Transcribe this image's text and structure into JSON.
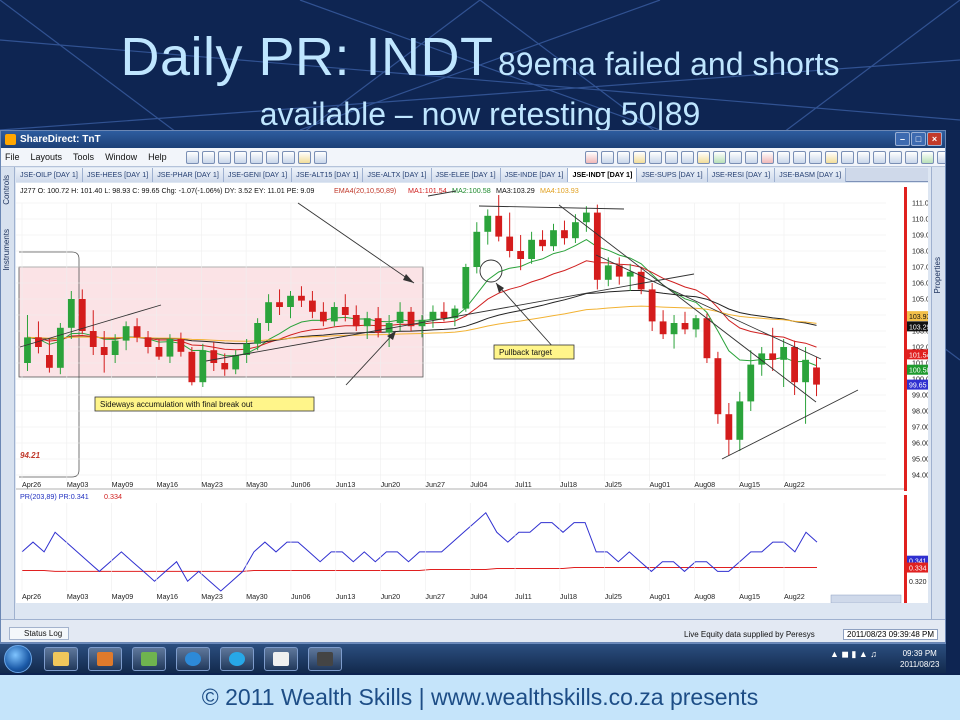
{
  "slide": {
    "title_main": "Daily PR: INDT",
    "title_sub": "89ema failed and shorts",
    "title_line2": "available – now retesting 50|89",
    "footer": "© 2011 Wealth Skills | www.wealthskills.co.za presents"
  },
  "window": {
    "title": "ShareDirect: TnT",
    "menu": [
      "File",
      "Layouts",
      "Tools",
      "Window",
      "Help"
    ],
    "side_tabs": [
      "Controls",
      "Instruments"
    ],
    "right_tab": "Properties",
    "tabs": [
      "JSE-OILP [DAY 1]",
      "JSE-HEES [DAY 1]",
      "JSE-PHAR [DAY 1]",
      "JSE-GENI [DAY 1]",
      "JSE-ALT15 [DAY 1]",
      "JSE-ALTX [DAY 1]",
      "JSE-ELEE [DAY 1]",
      "JSE-INDE [DAY 1]",
      "JSE-INDT [DAY 1]",
      "JSE-SUPS [DAY 1]",
      "JSE-RESI [DAY 1]",
      "JSE-BASM [DAY 1]"
    ],
    "active_tab": "JSE-INDT [DAY 1]",
    "status_log": "Status Log",
    "feed_text": "Live Equity data supplied by Peresys",
    "feed_time": "2011/08/23 09:39:48 PM"
  },
  "chart_header": {
    "ohlc": "J277 O: 100.72 H: 101.40 L: 98.93 C: 99.65 Chg: -1.07(-1.06%) DY: 3.52 EY: 11.01 PE: 9.09",
    "ema": "EMA4(20,10,50,89)",
    "ma1": "MA1:101.54",
    "ma2": "MA2:100.58",
    "ma3": "MA3:103.29",
    "ma4": "MA4:103.93",
    "pr_label": "PR(203,89) PR:0.341",
    "pr_value": "0.334"
  },
  "annotations": {
    "pullback": "Pullback target",
    "sideways": "Sideways accumulation with final break out",
    "low_value": "94.21"
  },
  "chart_data": {
    "type": "candlestick",
    "x_tick_labels": [
      "Apr26",
      "May03",
      "May09",
      "May16",
      "May23",
      "May30",
      "Jun06",
      "Jun13",
      "Jun20",
      "Jun27",
      "Jul04",
      "Jul11",
      "Jul18",
      "Jul25",
      "Aug01",
      "Aug08",
      "Aug15",
      "Aug22"
    ],
    "y_tick_labels": [
      "111.00",
      "110.00",
      "109.00",
      "108.00",
      "107.00",
      "106.00",
      "105.00",
      "104.00",
      "103.00",
      "102.00",
      "101.00",
      "100.00",
      "99.00",
      "98.00",
      "97.00",
      "96.00",
      "95.00",
      "94.00"
    ],
    "ylim": [
      94,
      111
    ],
    "price_markers": [
      {
        "value": "103.93",
        "color": "#f3c04a"
      },
      {
        "value": "103.29",
        "color": "#111111"
      },
      {
        "value": "101.54",
        "color": "#e02020"
      },
      {
        "value": "100.58",
        "color": "#1e9a2e"
      },
      {
        "value": "99.65",
        "color": "#3030d0"
      }
    ],
    "candles": [
      {
        "o": 101.0,
        "h": 104.0,
        "l": 100.5,
        "c": 102.6
      },
      {
        "o": 102.6,
        "h": 103.6,
        "l": 101.6,
        "c": 102.0
      },
      {
        "o": 101.5,
        "h": 102.5,
        "l": 100.4,
        "c": 100.7
      },
      {
        "o": 100.7,
        "h": 103.5,
        "l": 100.3,
        "c": 103.2
      },
      {
        "o": 103.2,
        "h": 105.5,
        "l": 102.5,
        "c": 105.0
      },
      {
        "o": 105.0,
        "h": 105.6,
        "l": 102.8,
        "c": 103.0
      },
      {
        "o": 103.0,
        "h": 104.3,
        "l": 101.5,
        "c": 102.0
      },
      {
        "o": 102.0,
        "h": 103.0,
        "l": 100.4,
        "c": 101.5
      },
      {
        "o": 101.5,
        "h": 102.8,
        "l": 101.0,
        "c": 102.4
      },
      {
        "o": 102.4,
        "h": 103.6,
        "l": 101.8,
        "c": 103.3
      },
      {
        "o": 103.3,
        "h": 103.8,
        "l": 102.3,
        "c": 102.6
      },
      {
        "o": 102.6,
        "h": 103.0,
        "l": 101.6,
        "c": 102.0
      },
      {
        "o": 102.0,
        "h": 102.5,
        "l": 101.2,
        "c": 101.4
      },
      {
        "o": 101.4,
        "h": 102.8,
        "l": 101.0,
        "c": 102.5
      },
      {
        "o": 102.5,
        "h": 102.9,
        "l": 101.4,
        "c": 101.7
      },
      {
        "o": 101.7,
        "h": 102.0,
        "l": 99.6,
        "c": 99.8
      },
      {
        "o": 99.8,
        "h": 102.2,
        "l": 99.5,
        "c": 101.8
      },
      {
        "o": 101.8,
        "h": 102.3,
        "l": 100.5,
        "c": 101.0
      },
      {
        "o": 101.0,
        "h": 101.6,
        "l": 100.2,
        "c": 100.6
      },
      {
        "o": 100.6,
        "h": 101.8,
        "l": 100.3,
        "c": 101.5
      },
      {
        "o": 101.5,
        "h": 102.5,
        "l": 101.0,
        "c": 102.2
      },
      {
        "o": 102.2,
        "h": 103.8,
        "l": 101.8,
        "c": 103.5
      },
      {
        "o": 103.5,
        "h": 105.3,
        "l": 103.0,
        "c": 104.8
      },
      {
        "o": 104.8,
        "h": 105.6,
        "l": 104.0,
        "c": 104.5
      },
      {
        "o": 104.5,
        "h": 105.5,
        "l": 103.8,
        "c": 105.2
      },
      {
        "o": 105.2,
        "h": 105.8,
        "l": 104.5,
        "c": 104.9
      },
      {
        "o": 104.9,
        "h": 105.5,
        "l": 103.8,
        "c": 104.2
      },
      {
        "o": 104.2,
        "h": 104.8,
        "l": 103.3,
        "c": 103.6
      },
      {
        "o": 103.6,
        "h": 104.8,
        "l": 103.3,
        "c": 104.5
      },
      {
        "o": 104.5,
        "h": 105.3,
        "l": 103.6,
        "c": 104.0
      },
      {
        "o": 104.0,
        "h": 104.6,
        "l": 103.0,
        "c": 103.3
      },
      {
        "o": 103.3,
        "h": 104.2,
        "l": 102.5,
        "c": 103.8
      },
      {
        "o": 103.8,
        "h": 104.5,
        "l": 102.6,
        "c": 102.9
      },
      {
        "o": 102.9,
        "h": 104.0,
        "l": 102.0,
        "c": 103.5
      },
      {
        "o": 103.5,
        "h": 104.8,
        "l": 103.0,
        "c": 104.2
      },
      {
        "o": 104.2,
        "h": 104.5,
        "l": 103.0,
        "c": 103.3
      },
      {
        "o": 103.3,
        "h": 104.0,
        "l": 102.6,
        "c": 103.7
      },
      {
        "o": 103.7,
        "h": 104.6,
        "l": 103.2,
        "c": 104.2
      },
      {
        "o": 104.2,
        "h": 104.8,
        "l": 103.6,
        "c": 103.8
      },
      {
        "o": 103.8,
        "h": 104.6,
        "l": 103.3,
        "c": 104.4
      },
      {
        "o": 104.4,
        "h": 107.2,
        "l": 104.2,
        "c": 107.0
      },
      {
        "o": 107.0,
        "h": 109.8,
        "l": 106.6,
        "c": 109.2
      },
      {
        "o": 109.2,
        "h": 110.6,
        "l": 108.4,
        "c": 110.2
      },
      {
        "o": 110.2,
        "h": 111.5,
        "l": 108.6,
        "c": 108.9
      },
      {
        "o": 108.9,
        "h": 110.4,
        "l": 107.6,
        "c": 108.0
      },
      {
        "o": 108.0,
        "h": 109.0,
        "l": 106.8,
        "c": 107.5
      },
      {
        "o": 107.5,
        "h": 109.2,
        "l": 107.2,
        "c": 108.7
      },
      {
        "o": 108.7,
        "h": 109.3,
        "l": 108.0,
        "c": 108.3
      },
      {
        "o": 108.3,
        "h": 109.7,
        "l": 108.0,
        "c": 109.3
      },
      {
        "o": 109.3,
        "h": 109.9,
        "l": 108.4,
        "c": 108.8
      },
      {
        "o": 108.8,
        "h": 110.3,
        "l": 108.5,
        "c": 109.8
      },
      {
        "o": 109.8,
        "h": 110.8,
        "l": 109.2,
        "c": 110.4
      },
      {
        "o": 110.4,
        "h": 110.9,
        "l": 105.6,
        "c": 106.2
      },
      {
        "o": 106.2,
        "h": 107.6,
        "l": 105.8,
        "c": 107.1
      },
      {
        "o": 107.1,
        "h": 107.6,
        "l": 105.9,
        "c": 106.4
      },
      {
        "o": 106.4,
        "h": 107.2,
        "l": 105.5,
        "c": 106.7
      },
      {
        "o": 106.7,
        "h": 107.0,
        "l": 105.3,
        "c": 105.6
      },
      {
        "o": 105.6,
        "h": 106.0,
        "l": 103.0,
        "c": 103.6
      },
      {
        "o": 103.6,
        "h": 104.3,
        "l": 102.5,
        "c": 102.8
      },
      {
        "o": 102.8,
        "h": 104.0,
        "l": 101.9,
        "c": 103.5
      },
      {
        "o": 103.5,
        "h": 104.2,
        "l": 102.8,
        "c": 103.1
      },
      {
        "o": 103.1,
        "h": 104.0,
        "l": 102.6,
        "c": 103.8
      },
      {
        "o": 103.8,
        "h": 104.1,
        "l": 101.0,
        "c": 101.3
      },
      {
        "o": 101.3,
        "h": 101.7,
        "l": 97.2,
        "c": 97.8
      },
      {
        "o": 97.8,
        "h": 98.5,
        "l": 95.2,
        "c": 96.2
      },
      {
        "o": 96.2,
        "h": 99.2,
        "l": 95.5,
        "c": 98.6
      },
      {
        "o": 98.6,
        "h": 101.8,
        "l": 98.0,
        "c": 100.9
      },
      {
        "o": 100.9,
        "h": 102.0,
        "l": 100.2,
        "c": 101.6
      },
      {
        "o": 101.6,
        "h": 103.2,
        "l": 100.5,
        "c": 101.2
      },
      {
        "o": 101.2,
        "h": 102.5,
        "l": 99.5,
        "c": 102.0
      },
      {
        "o": 102.0,
        "h": 102.4,
        "l": 99.0,
        "c": 99.8
      },
      {
        "o": 99.8,
        "h": 102.0,
        "l": 97.2,
        "c": 101.2
      },
      {
        "o": 100.72,
        "h": 101.4,
        "l": 98.93,
        "c": 99.65
      }
    ],
    "pr_series_blue": [
      0.35,
      0.36,
      0.35,
      0.37,
      0.36,
      0.35,
      0.34,
      0.33,
      0.34,
      0.35,
      0.34,
      0.33,
      0.32,
      0.33,
      0.34,
      0.32,
      0.33,
      0.32,
      0.31,
      0.32,
      0.33,
      0.35,
      0.36,
      0.35,
      0.36,
      0.36,
      0.35,
      0.34,
      0.35,
      0.35,
      0.34,
      0.35,
      0.34,
      0.35,
      0.35,
      0.34,
      0.35,
      0.35,
      0.35,
      0.36,
      0.37,
      0.38,
      0.39,
      0.37,
      0.36,
      0.37,
      0.37,
      0.38,
      0.38,
      0.37,
      0.38,
      0.38,
      0.35,
      0.35,
      0.34,
      0.35,
      0.34,
      0.33,
      0.34,
      0.34,
      0.33,
      0.34,
      0.34,
      0.33,
      0.33,
      0.34,
      0.35,
      0.35,
      0.36,
      0.36,
      0.35,
      0.37,
      0.36
    ],
    "pr_series_red": [
      0.331,
      0.331,
      0.331,
      0.33,
      0.33,
      0.33,
      0.33,
      0.33,
      0.33,
      0.33,
      0.33,
      0.33,
      0.33,
      0.33,
      0.33,
      0.33,
      0.33,
      0.33,
      0.33,
      0.33,
      0.33,
      0.331,
      0.331,
      0.331,
      0.331,
      0.331,
      0.331,
      0.331,
      0.331,
      0.331,
      0.331,
      0.331,
      0.331,
      0.331,
      0.331,
      0.331,
      0.331,
      0.332,
      0.332,
      0.332,
      0.332,
      0.332,
      0.332,
      0.333,
      0.333,
      0.333,
      0.333,
      0.333,
      0.333,
      0.333,
      0.334,
      0.334,
      0.334,
      0.334,
      0.334,
      0.334,
      0.334,
      0.334,
      0.334,
      0.334,
      0.334,
      0.334,
      0.334,
      0.334,
      0.334,
      0.334,
      0.334,
      0.334,
      0.334,
      0.334,
      0.334,
      0.334,
      0.334
    ],
    "pr_tick_labels": [
      "0.341",
      "0.334",
      "0.320"
    ],
    "pr_ylim": [
      0.31,
      0.4
    ]
  },
  "taskbar": {
    "clock_time": "09:39 PM",
    "clock_date": "2011/08/23"
  }
}
